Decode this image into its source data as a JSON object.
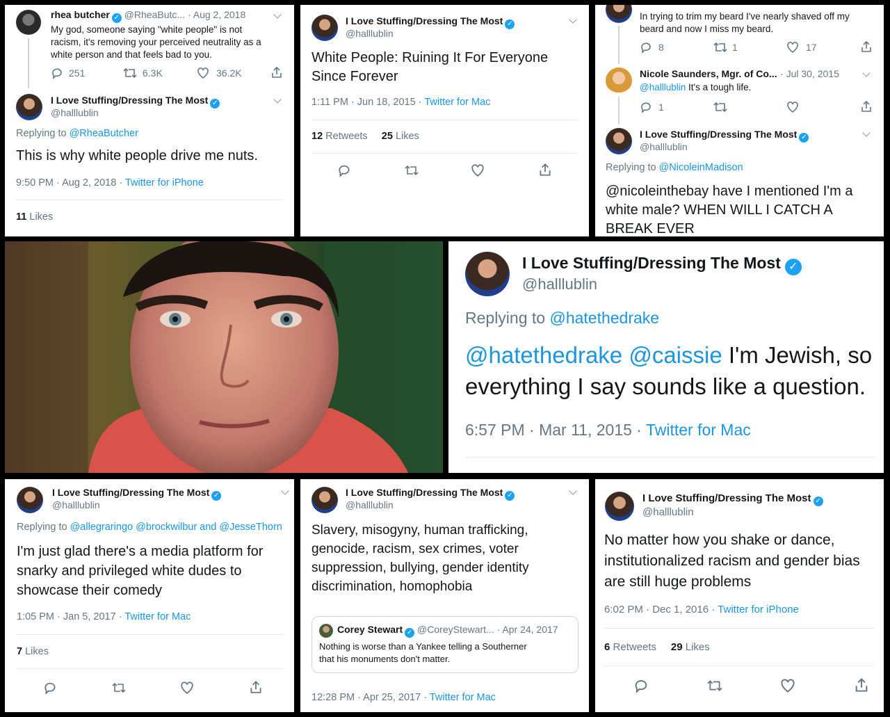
{
  "tweets": {
    "t1": {
      "quoted": {
        "name": "rhea butcher",
        "handle": "@RheaButc...",
        "date": "· Aug 2, 2018",
        "text_lines": [
          "My god, someone saying \"white people\" is not",
          "racism, it's removing your perceived neutrality as a",
          "white person and that feels bad to you."
        ],
        "replies": "251",
        "retweets": "6.3K",
        "likes": "36.2K"
      },
      "name": "I Love Stuffing/Dressing The Most",
      "handle": "@halllublin",
      "replying_label": "Replying to",
      "replying_to": "@RheaButcher",
      "text": "This is why white people drive me nuts.",
      "time": "9:50 PM · Aug 2, 2018 ·",
      "client": "Twitter for iPhone",
      "likes_count": "11",
      "likes_label": "Likes"
    },
    "t2": {
      "name": "I Love Stuffing/Dressing The Most",
      "handle": "@halllublin",
      "text_lines": [
        "White People: Ruining It For Everyone",
        "Since Forever"
      ],
      "time": "1:11 PM · Jun 18, 2015 ·",
      "client": "Twitter for Mac",
      "retweets_count": "12",
      "retweets_label": "Retweets",
      "likes_count": "25",
      "likes_label": "Likes"
    },
    "t3": {
      "top_text_lines": [
        "In trying to trim my beard I've nearly shaved off my",
        "beard and now I miss my beard."
      ],
      "top_replies": "8",
      "top_retweets": "1",
      "top_likes": "17",
      "mid_name": "Nicole Saunders, Mgr. of Co...",
      "mid_date": "· Jul 30, 2015",
      "mid_mention": "@halllublin",
      "mid_text": "It's a tough life.",
      "mid_replies": "1",
      "name": "I Love Stuffing/Dressing The Most",
      "handle": "@halllublin",
      "replying_label": "Replying to",
      "replying_to": "@NicoleinMadison",
      "text_lines": [
        "@nicoleinthebay have I mentioned I'm a",
        "white male? WHEN WILL I CATCH A",
        "BREAK EVER"
      ]
    },
    "t4": {
      "name": "I Love Stuffing/Dressing The Most",
      "handle": "@halllublin",
      "replying_label": "Replying to",
      "replying_to": "@hatethedrake",
      "mention1": "@hatethedrake",
      "mention2": "@caissie",
      "text_line1": "I'm Jewish, so",
      "text_line2": "everything I say sounds like a question.",
      "time": "6:57 PM · Mar 11, 2015 ·",
      "client": "Twitter for Mac"
    },
    "t5": {
      "name": "I Love Stuffing/Dressing The Most",
      "handle": "@halllublin",
      "replying_label": "Replying to",
      "replying_to": "@allegraringo @brockwilbur and @JesseThorn",
      "text_lines": [
        "I'm just glad there's a media platform for",
        "snarky and privileged white dudes to",
        "showcase their comedy"
      ],
      "time": "1:05 PM · Jan 5, 2017 ·",
      "client": "Twitter for Mac",
      "likes_count": "7",
      "likes_label": "Likes"
    },
    "t6": {
      "name": "I Love Stuffing/Dressing The Most",
      "handle": "@halllublin",
      "text_lines": [
        "Slavery, misogyny, human trafficking,",
        "genocide, racism, sex crimes, voter",
        "suppression, bullying, gender identity",
        "discrimination, homophobia"
      ],
      "quote_name": "Corey Stewart",
      "quote_handle": "@CoreyStewart...",
      "quote_date": "· Apr 24, 2017",
      "quote_text_lines": [
        "Nothing is worse than a Yankee telling a Southerner",
        "that his monuments don't matter."
      ],
      "time": "12:28 PM · Apr 25, 2017 ·",
      "client": "Twitter for Mac"
    },
    "t7": {
      "name": "I Love Stuffing/Dressing The Most",
      "handle": "@halllublin",
      "text_lines": [
        "No matter how you shake or dance,",
        "institutionalized racism and gender bias",
        "are still huge problems"
      ],
      "time": "6:02 PM · Dec 1, 2016 ·",
      "client": "Twitter for iPhone",
      "retweets_count": "6",
      "retweets_label": "Retweets",
      "likes_count": "29",
      "likes_label": "Likes"
    }
  },
  "colors": {
    "link": "#1b95e0",
    "muted": "#657786",
    "verified": "#1da1f2",
    "divider": "#e6ecf0"
  },
  "icons": [
    "reply-icon",
    "retweet-icon",
    "like-icon",
    "share-icon",
    "verified-icon",
    "chevron-down-icon"
  ]
}
